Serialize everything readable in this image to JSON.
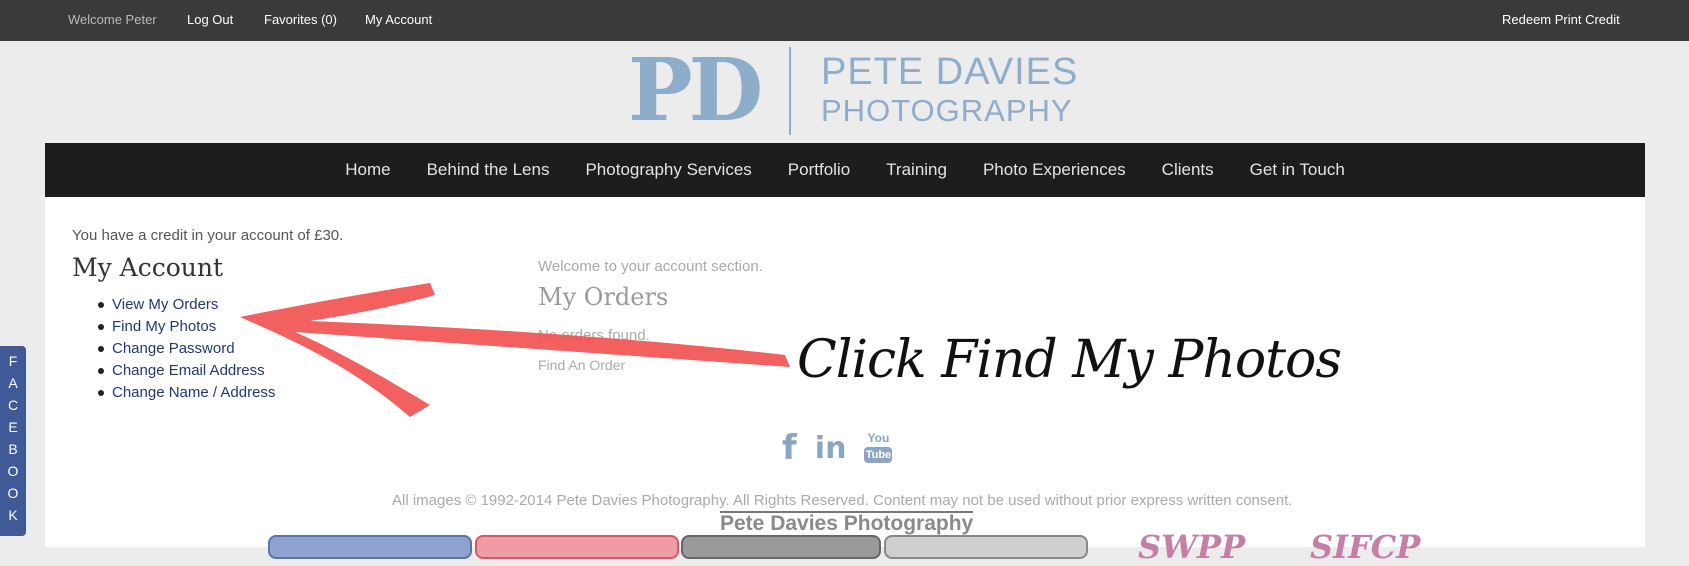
{
  "topbar": {
    "welcome": "Welcome Peter",
    "logout": "Log Out",
    "favorites": "Favorites (0)",
    "my_account": "My Account",
    "redeem": "Redeem Print Credit"
  },
  "logo": {
    "initials": "PD",
    "line1": "PETE DAVIES",
    "line2": "PHOTOGRAPHY"
  },
  "nav": {
    "items": [
      "Home",
      "Behind the Lens",
      "Photography Services",
      "Portfolio",
      "Training",
      "Photo Experiences",
      "Clients",
      "Get in Touch"
    ]
  },
  "account": {
    "credit_text": "You have a credit in your account of £30.",
    "heading": "My Account",
    "links": [
      "View My Orders",
      "Find My Photos",
      "Change Password",
      "Change Email Address",
      "Change Name / Address"
    ]
  },
  "main": {
    "welcome": "Welcome to your account section.",
    "orders_heading": "My Orders",
    "no_orders": "No orders found.",
    "find_order": "Find An Order"
  },
  "annotation": {
    "text": "Click Find My Photos",
    "arrow_color": "#f04a4a"
  },
  "social": {
    "icons": [
      "facebook-icon",
      "linkedin-icon",
      "youtube-icon"
    ],
    "youtube_top": "You",
    "youtube_bottom": "Tube"
  },
  "footer": {
    "copyright": "All images © 1992-2014 Pete Davies Photography. All Rights Reserved. Content may not be used without prior express written consent.",
    "brand": "Pete Davies Photography",
    "swpp": "SWPP",
    "sinwp": "SIFCP"
  },
  "facebook_tab": {
    "letters": [
      "F",
      "A",
      "C",
      "E",
      "B",
      "O",
      "O",
      "K"
    ]
  },
  "colors": {
    "topbar": "#3a3a3a",
    "navbar": "#1d1d1f",
    "logo": "#8dadca",
    "link": "#1e3a6e",
    "facebook_tab": "#3f5a96"
  }
}
